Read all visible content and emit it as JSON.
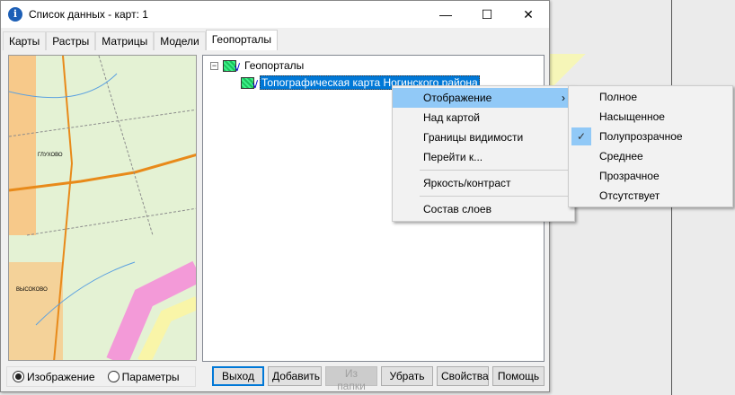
{
  "window": {
    "title": "Список данных -   карт: 1",
    "minimize": "—",
    "maximize": "☐",
    "close": "✕"
  },
  "tabs": [
    {
      "label": "Карты"
    },
    {
      "label": "Растры"
    },
    {
      "label": "Матрицы"
    },
    {
      "label": "Модели"
    },
    {
      "label": "Геопорталы",
      "active": true
    }
  ],
  "tree": {
    "root": "Геопорталы",
    "expander": "−",
    "child": "Топографическая карта Ногинского района"
  },
  "map_labels": [
    "ГЛУХОВО",
    "ВЫСОКОВО"
  ],
  "view_mode": {
    "options": [
      "Изображение",
      "Параметры"
    ],
    "selected": "Изображение"
  },
  "buttons": [
    {
      "label": "Выход",
      "default": true
    },
    {
      "label": "Добавить"
    },
    {
      "label": "Из папки",
      "disabled": true
    },
    {
      "label": "Убрать"
    },
    {
      "label": "Свойства"
    },
    {
      "label": "Помощь"
    }
  ],
  "context_menu": {
    "items": [
      "Отображение",
      "Над картой",
      "Границы видимости",
      "Перейти к...",
      "Яркость/контраст",
      "Состав слоев"
    ],
    "submenu_arrow": "›"
  },
  "submenu": {
    "items": [
      "Полное",
      "Насыщенное",
      "Полупрозрачное",
      "Среднее",
      "Прозрачное",
      "Отсутствует"
    ],
    "checked": "Полупрозрачное",
    "check": "✓"
  },
  "colors": {
    "selection": "#0078d7",
    "menu_highlight": "#91c9f7"
  }
}
